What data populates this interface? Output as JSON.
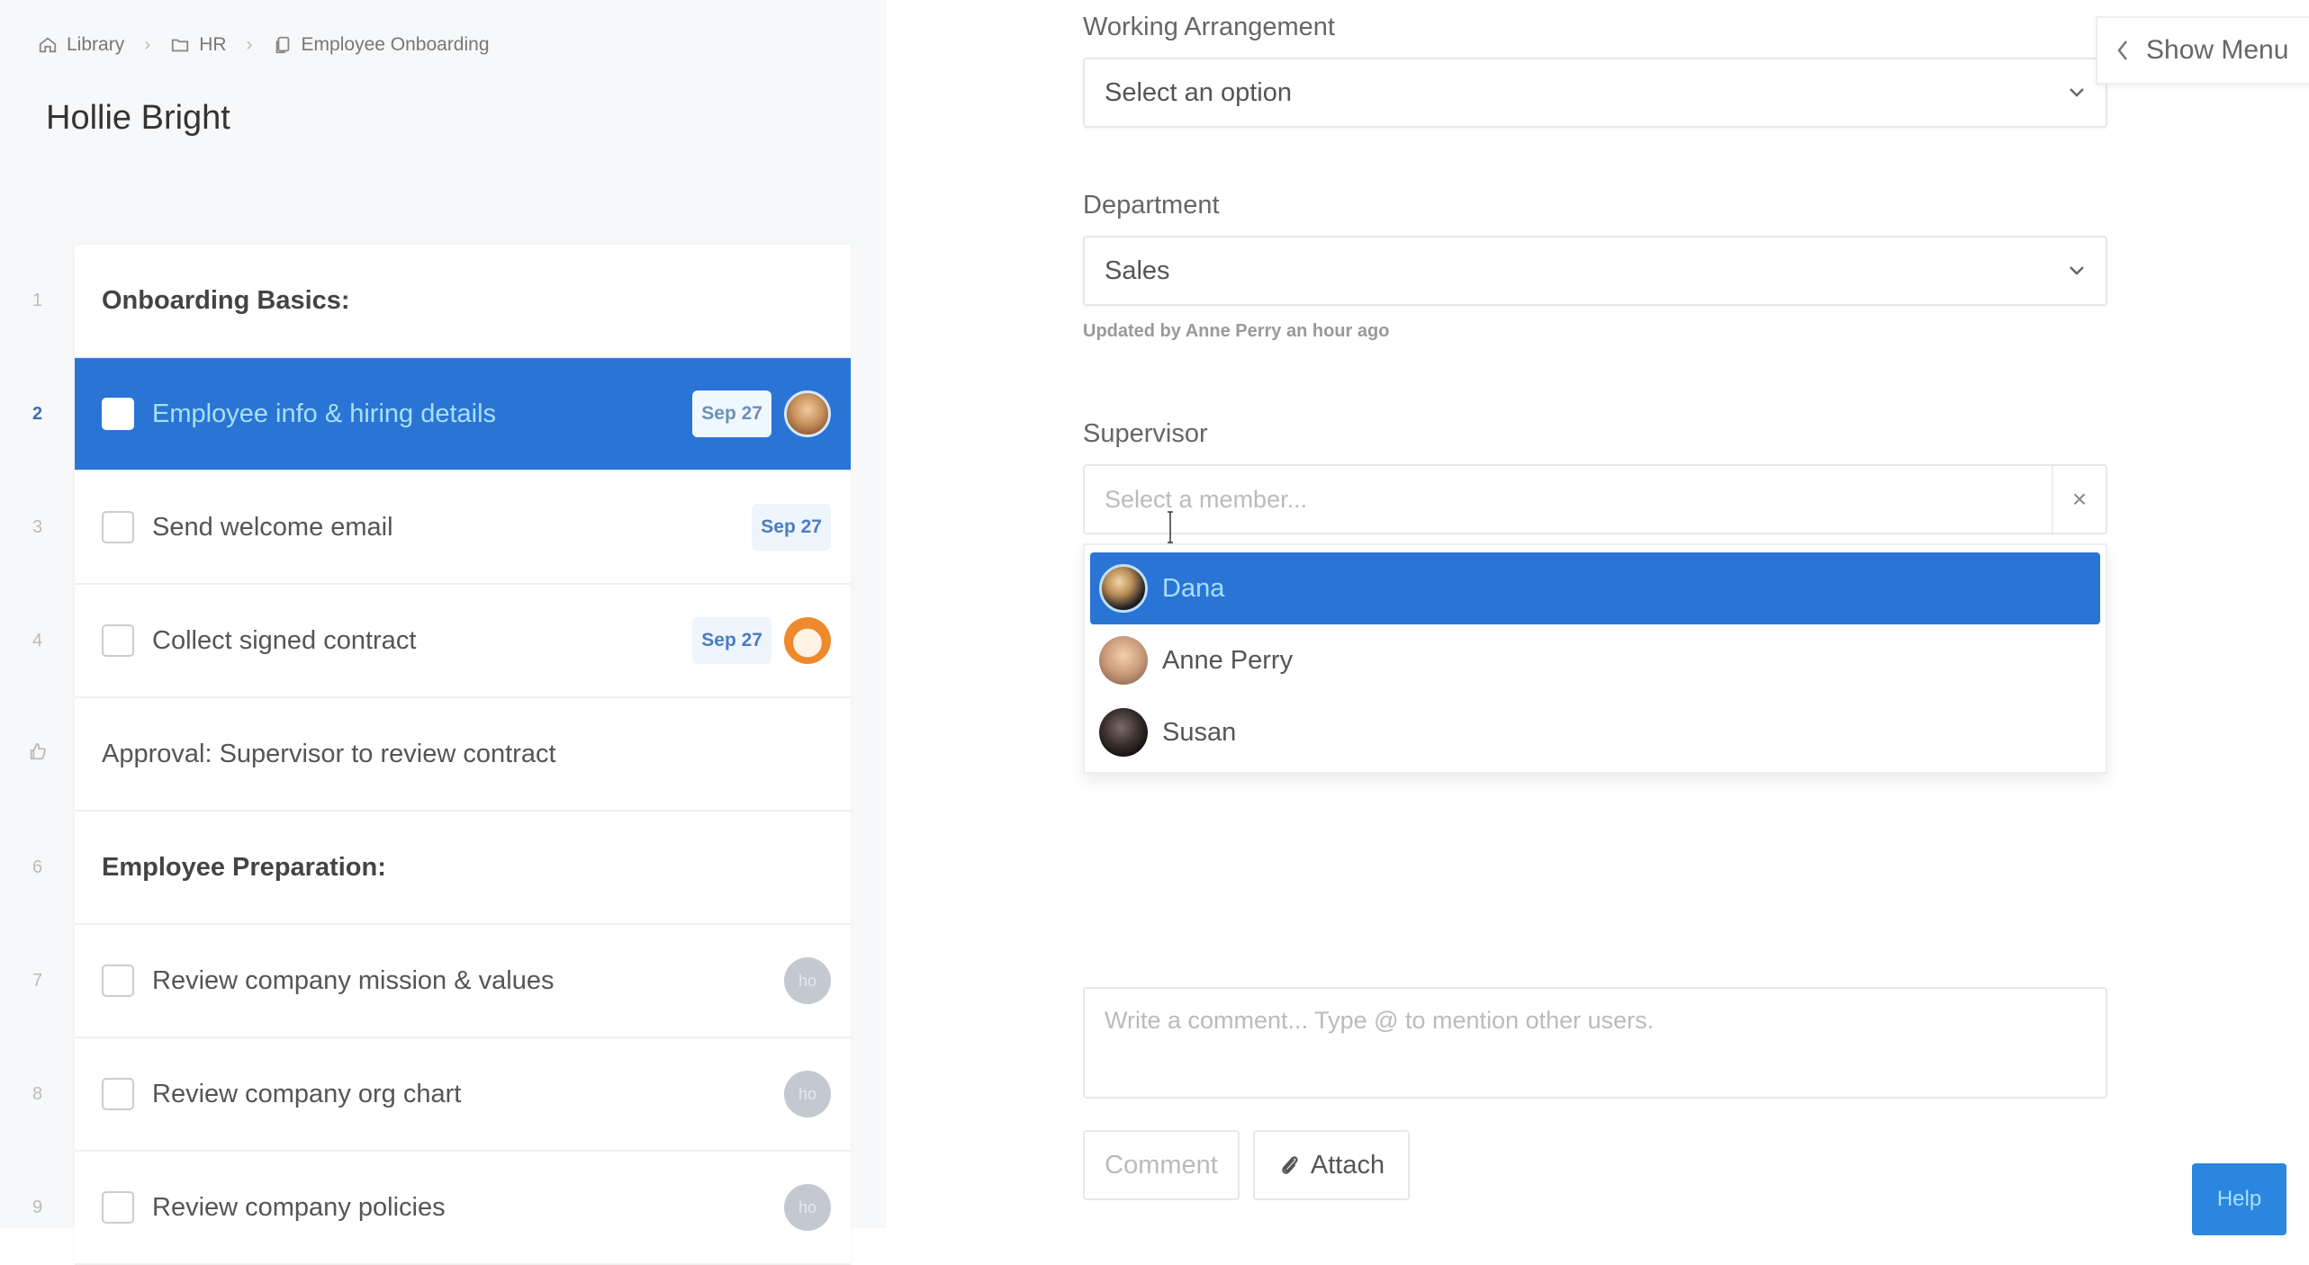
{
  "breadcrumb": [
    {
      "label": "Library",
      "icon": "home-icon"
    },
    {
      "label": "HR",
      "icon": "folder-icon"
    },
    {
      "label": "Employee Onboarding",
      "icon": "document-copy-icon"
    }
  ],
  "page_title": "Hollie Bright",
  "checklist": {
    "rows": [
      {
        "num": "1",
        "type": "heading",
        "label": "Onboarding Basics:"
      },
      {
        "num": "2",
        "type": "task",
        "label": "Employee info & hiring details",
        "date": "Sep 27",
        "assignee": "photo",
        "active": true
      },
      {
        "num": "3",
        "type": "task",
        "label": "Send welcome email",
        "date": "Sep 27"
      },
      {
        "num": "4",
        "type": "task",
        "label": "Collect signed contract",
        "date": "Sep 27",
        "assignee": "orange"
      },
      {
        "num": "thumbs-up-icon",
        "type": "approval",
        "label": "Approval: Supervisor to review contract"
      },
      {
        "num": "6",
        "type": "heading",
        "label": "Employee Preparation:"
      },
      {
        "num": "7",
        "type": "task",
        "label": "Review company mission & values",
        "assignee_initials": "ho"
      },
      {
        "num": "8",
        "type": "task",
        "label": "Review company org chart",
        "assignee_initials": "ho"
      },
      {
        "num": "9",
        "type": "task",
        "label": "Review company policies",
        "assignee_initials": "ho"
      }
    ]
  },
  "form": {
    "working_arrangement": {
      "label": "Working Arrangement",
      "value": "Select an option"
    },
    "department": {
      "label": "Department",
      "value": "Sales",
      "meta": "Updated by Anne Perry an hour ago"
    },
    "supervisor": {
      "label": "Supervisor",
      "placeholder": "Select a member...",
      "clear_label": "×",
      "options": [
        {
          "name": "Dana",
          "selected": true
        },
        {
          "name": "Anne Perry",
          "selected": false
        },
        {
          "name": "Susan",
          "selected": false
        }
      ]
    },
    "comment": {
      "placeholder": "Write a comment... Type @ to mention other users."
    },
    "buttons": {
      "comment": "Comment",
      "attach": "Attach"
    }
  },
  "show_menu": "Show Menu",
  "help": "Help",
  "colors": {
    "accent": "#2a74d6",
    "help": "#2b86e0",
    "selected_text": "#a6e0f7",
    "orange": "#ee8a2b"
  }
}
